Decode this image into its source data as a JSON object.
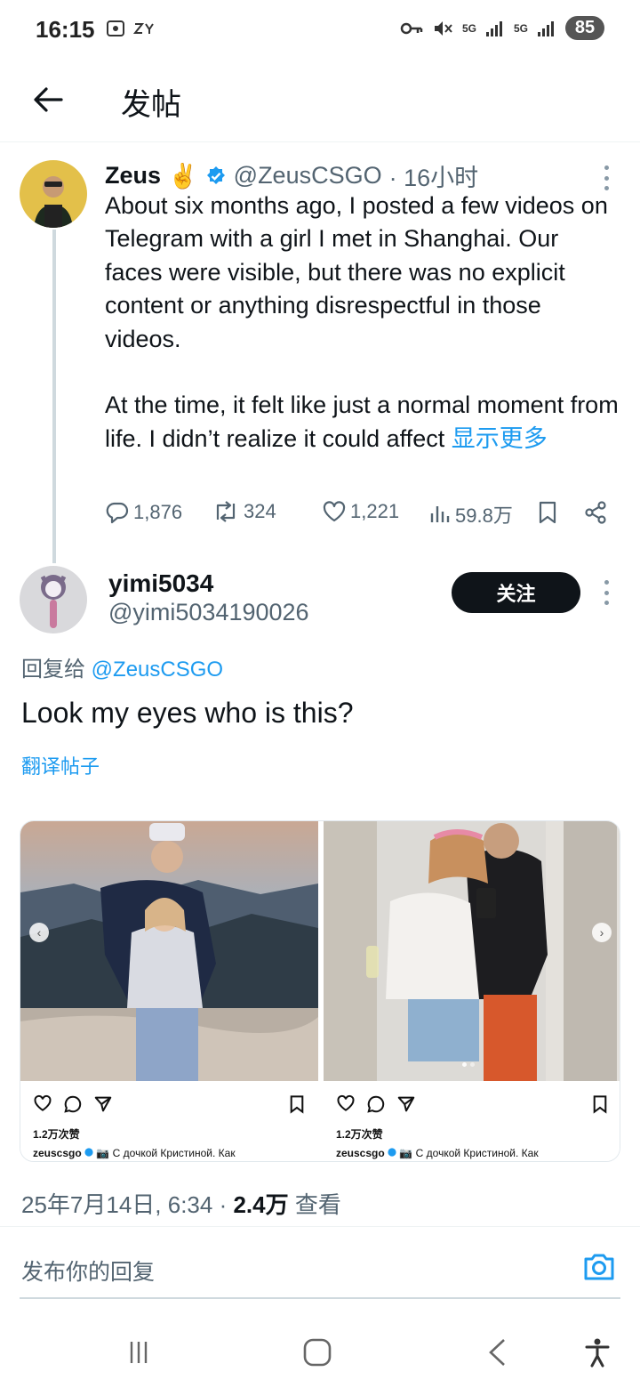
{
  "status_bar": {
    "time": "16:15",
    "network_a": "5G",
    "network_b": "5G",
    "battery": "85"
  },
  "header": {
    "title": "发帖",
    "back_icon": "arrow-left-icon"
  },
  "post": {
    "author_name": "Zeus",
    "author_emoji": "✌️",
    "verified_icon": "verified-badge-icon",
    "handle": "@ZeusCSGO",
    "time": "· 16小时",
    "body_p1": "About six months ago, I posted a few videos on Telegram with a girl I met in Shanghai. Our faces were visible, but there was no explicit content or anything disrespectful in those videos.",
    "body_p2": "At the time, it felt like just a normal moment from life. I didn’t realize it could affect",
    "show_more": "显示更多",
    "replies": "1,876",
    "reposts": "324",
    "likes": "1,221",
    "views": "59.8万"
  },
  "reply": {
    "author_name": "yimi5034",
    "handle": "@yimi5034190026",
    "follow_label": "关注",
    "reply_to_prefix": "回复给 ",
    "reply_to_mention": "@ZeusCSGO",
    "text": "Look my eyes who is this?",
    "translate_label": "翻译帖子",
    "media": [
      {
        "likes": "1.2万次赞",
        "username": "zeuscsgo",
        "caption": "📷 С дочкой Кристиной. Как"
      },
      {
        "likes": "1.2万次赞",
        "username": "zeuscsgo",
        "caption": "📷 С дочкой Кристиной. Как"
      }
    ],
    "timestamp": "25年7月14日, 6:34 · ",
    "view_count": "2.4万",
    "view_label": " 查看"
  },
  "composer": {
    "placeholder": "发布你的回复"
  },
  "colors": {
    "accent": "#1d9bf0",
    "text": "#0f1419",
    "muted": "#536471"
  }
}
